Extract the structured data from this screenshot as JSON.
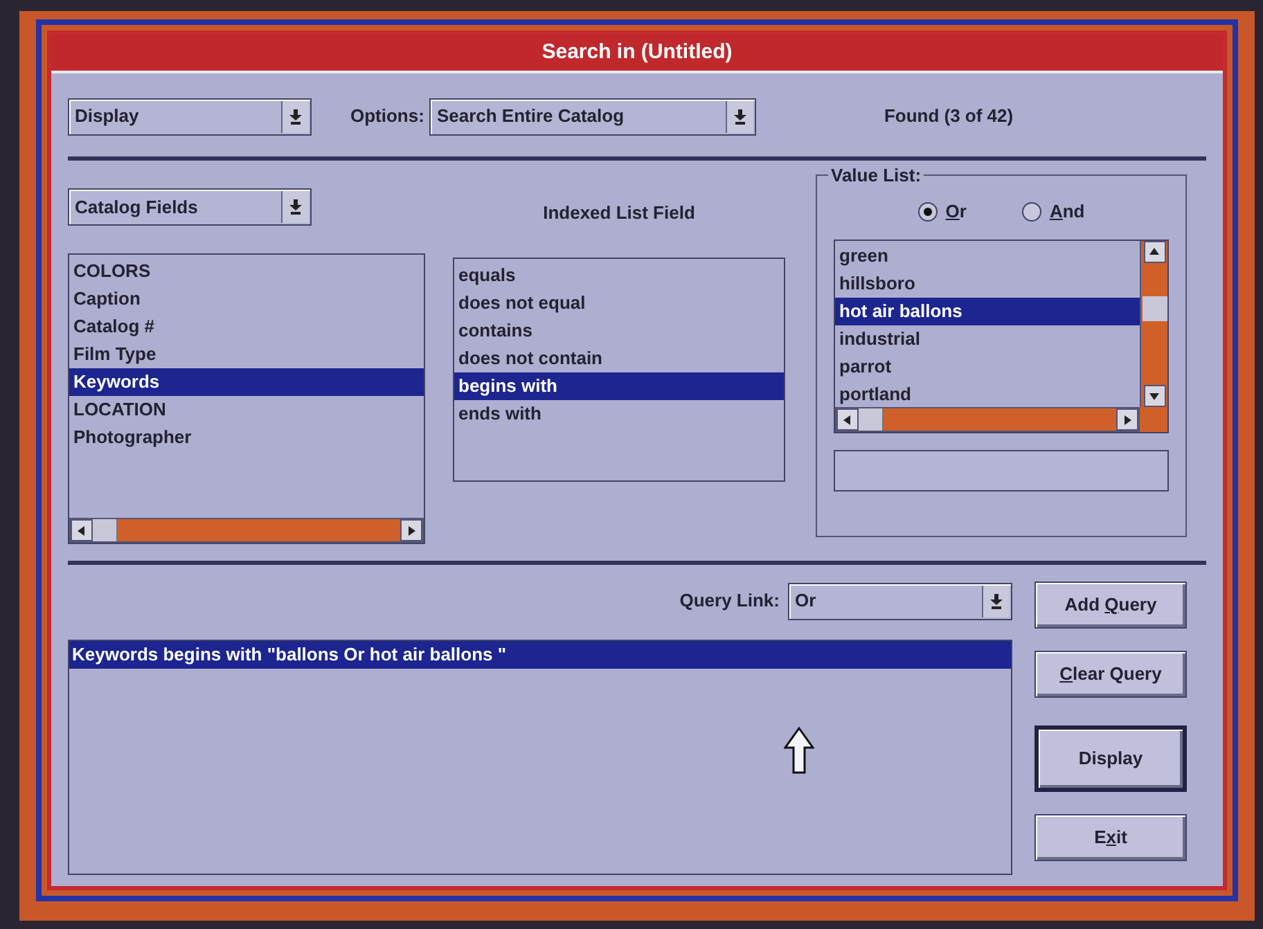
{
  "window": {
    "title": "Search in (Untitled)"
  },
  "top": {
    "mode_dropdown": {
      "value": "Display"
    },
    "options_label": "Options:",
    "options_dropdown": {
      "value": "Search Entire Catalog"
    },
    "found": "Found (3 of 42)"
  },
  "fields": {
    "dropdown": {
      "value": "Catalog Fields"
    },
    "items": [
      {
        "label": "COLORS",
        "selected": false
      },
      {
        "label": "Caption",
        "selected": false
      },
      {
        "label": "Catalog #",
        "selected": false
      },
      {
        "label": "Film Type",
        "selected": false
      },
      {
        "label": "Keywords",
        "selected": true
      },
      {
        "label": "LOCATION",
        "selected": false
      },
      {
        "label": "Photographer",
        "selected": false
      }
    ]
  },
  "operators": {
    "heading": "Indexed List Field",
    "items": [
      {
        "label": "equals",
        "selected": false
      },
      {
        "label": "does not equal",
        "selected": false
      },
      {
        "label": "contains",
        "selected": false
      },
      {
        "label": "does not contain",
        "selected": false
      },
      {
        "label": "begins with",
        "selected": true
      },
      {
        "label": "ends with",
        "selected": false
      }
    ]
  },
  "value_list": {
    "legend": "Value List:",
    "radios": [
      {
        "label": {
          "accel": "O",
          "after": "r"
        },
        "selected": true
      },
      {
        "label": {
          "accel": "A",
          "after": "nd"
        },
        "selected": false
      }
    ],
    "items": [
      {
        "label": "green",
        "selected": false
      },
      {
        "label": "hillsboro",
        "selected": false
      },
      {
        "label": "hot air ballons",
        "selected": true
      },
      {
        "label": "industrial",
        "selected": false
      },
      {
        "label": "parrot",
        "selected": false
      },
      {
        "label": "portland",
        "selected": false
      }
    ]
  },
  "query": {
    "link_label": "Query Link:",
    "link_dropdown": {
      "value": "Or"
    },
    "items": [
      {
        "text": "Keywords begins with \"ballons Or hot air ballons \"",
        "selected": true
      }
    ]
  },
  "buttons": [
    {
      "label": {
        "before": "Add ",
        "accel": "Q",
        "after": "uery"
      },
      "default": false
    },
    {
      "label": {
        "accel": "C",
        "after": "lear Query"
      },
      "default": false
    },
    {
      "label": {
        "before": "Display"
      },
      "default": true
    },
    {
      "label": {
        "before": "E",
        "accel": "x",
        "after": "it"
      },
      "default": false
    }
  ]
}
